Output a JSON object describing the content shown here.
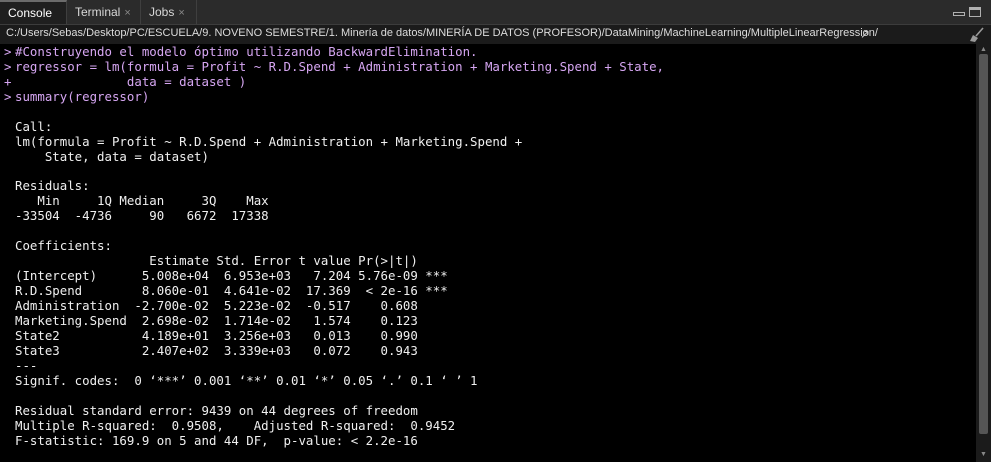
{
  "tabs": [
    {
      "label": "Console",
      "closable": false
    },
    {
      "label": "Terminal",
      "closable": true
    },
    {
      "label": "Jobs",
      "closable": true
    }
  ],
  "close_glyph": "×",
  "path": "C:/Users/Sebas/Desktop/PC/ESCUELA/9. NOVENO SEMESTRE/1. Minería de datos/MINERÍA DE DATOS (PROFESOR)/DataMining/MachineLearning/MultipleLinearRegression/",
  "path_arrow": "↗",
  "icons": {
    "minimize": "minimize-icon",
    "maximize": "maximize-icon",
    "clear_console": "broom-icon",
    "goto_dir": "arrow-icon"
  },
  "colors": {
    "command": "#d6a6f2",
    "output": "#f0f0f0",
    "background": "#000000"
  },
  "console": {
    "prompts": [
      ">",
      ">",
      "+",
      ">"
    ],
    "commands": [
      "#Construyendo el modelo óptimo utilizando BackwardElimination.",
      "regressor = lm(formula = Profit ~ R.D.Spend + Administration + Marketing.Spend + State,",
      "               data = dataset )",
      "summary(regressor)"
    ],
    "output": [
      "Call:",
      "lm(formula = Profit ~ R.D.Spend + Administration + Marketing.Spend + ",
      "    State, data = dataset)",
      "Residuals:",
      "   Min     1Q Median     3Q    Max ",
      "-33504  -4736     90   6672  17338 ",
      "Coefficients:",
      "                  Estimate Std. Error t value Pr(>|t|)    ",
      "(Intercept)      5.008e+04  6.953e+03   7.204 5.76e-09 ***",
      "R.D.Spend        8.060e-01  4.641e-02  17.369  < 2e-16 ***",
      "Administration  -2.700e-02  5.223e-02  -0.517    0.608    ",
      "Marketing.Spend  2.698e-02  1.714e-02   1.574    0.123    ",
      "State2           4.189e+01  3.256e+03   0.013    0.990    ",
      "State3           2.407e+02  3.339e+03   0.072    0.943    ",
      "---",
      "Signif. codes:  0 ‘***’ 0.001 ‘**’ 0.01 ‘*’ 0.05 ‘.’ 0.1 ‘ ’ 1",
      "Residual standard error: 9439 on 44 degrees of freedom",
      "Multiple R-squared:  0.9508,\tAdjusted R-squared:  0.9452 ",
      "F-statistic: 169.9 on 5 and 44 DF,  p-value: < 2.2e-16"
    ]
  }
}
